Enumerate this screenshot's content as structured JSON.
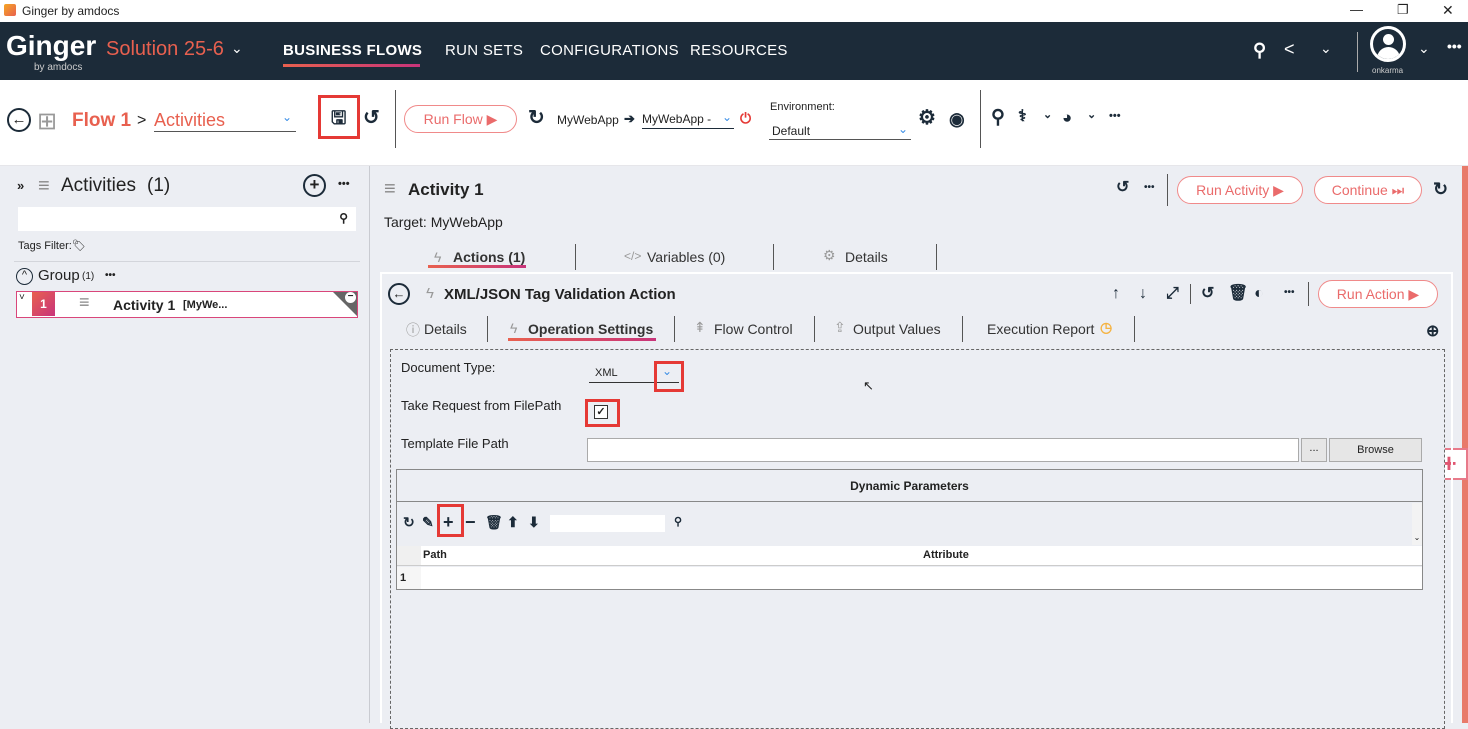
{
  "window": {
    "title": "Ginger by amdocs",
    "minimize": "—",
    "maximize": "❐",
    "close": "✕"
  },
  "header": {
    "logo": "Ginger",
    "logo_sub": "by amdocs",
    "solution": "Solution 25-6",
    "nav": [
      "BUSINESS FLOWS",
      "RUN SETS",
      "CONFIGURATIONS",
      "RESOURCES"
    ],
    "active_nav": "BUSINESS FLOWS",
    "user": "onkarma",
    "accent": "#e8604f"
  },
  "toolbar": {
    "flow_name": "Flow 1",
    "separator": ">",
    "view_select": "Activities",
    "run_flow": "Run Flow",
    "target_app": "MyWebApp",
    "target_agent": "MyWebApp -",
    "environment_label": "Environment:",
    "environment_value": "Default"
  },
  "activities_panel": {
    "title": "Activities",
    "count": "(1)",
    "search_placeholder": "",
    "tags_filter": "Tags Filter:",
    "group_name": "Group",
    "group_count": "(1)",
    "items": [
      {
        "index": "1",
        "name": "Activity 1",
        "target": "[MyWe..."
      }
    ]
  },
  "activity": {
    "title": "Activity 1",
    "target": "Target: MyWebApp",
    "run_activity": "Run Activity",
    "continue": "Continue",
    "tabs": [
      {
        "label": "Actions (1)",
        "active": true
      },
      {
        "label": "Variables (0)"
      },
      {
        "label": "Details"
      }
    ]
  },
  "action": {
    "title": "XML/JSON Tag Validation Action",
    "run_action": "Run Action",
    "tabs": [
      {
        "label": "Details"
      },
      {
        "label": "Operation Settings",
        "active": true
      },
      {
        "label": "Flow Control"
      },
      {
        "label": "Output Values"
      },
      {
        "label": "Execution Report"
      }
    ]
  },
  "operation_settings": {
    "document_type_label": "Document Type:",
    "document_type_value": "XML",
    "take_request_label": "Take Request from FilePath",
    "take_request_checked": true,
    "template_label": "Template File Path",
    "template_value": "",
    "ellipsis_button": "...",
    "browse_button": "Browse",
    "dynamic_params_title": "Dynamic Parameters",
    "grid_columns": [
      "Path",
      "Attribute"
    ],
    "grid_rows": [
      {
        "row": "1",
        "path": "",
        "attribute": ""
      }
    ]
  }
}
